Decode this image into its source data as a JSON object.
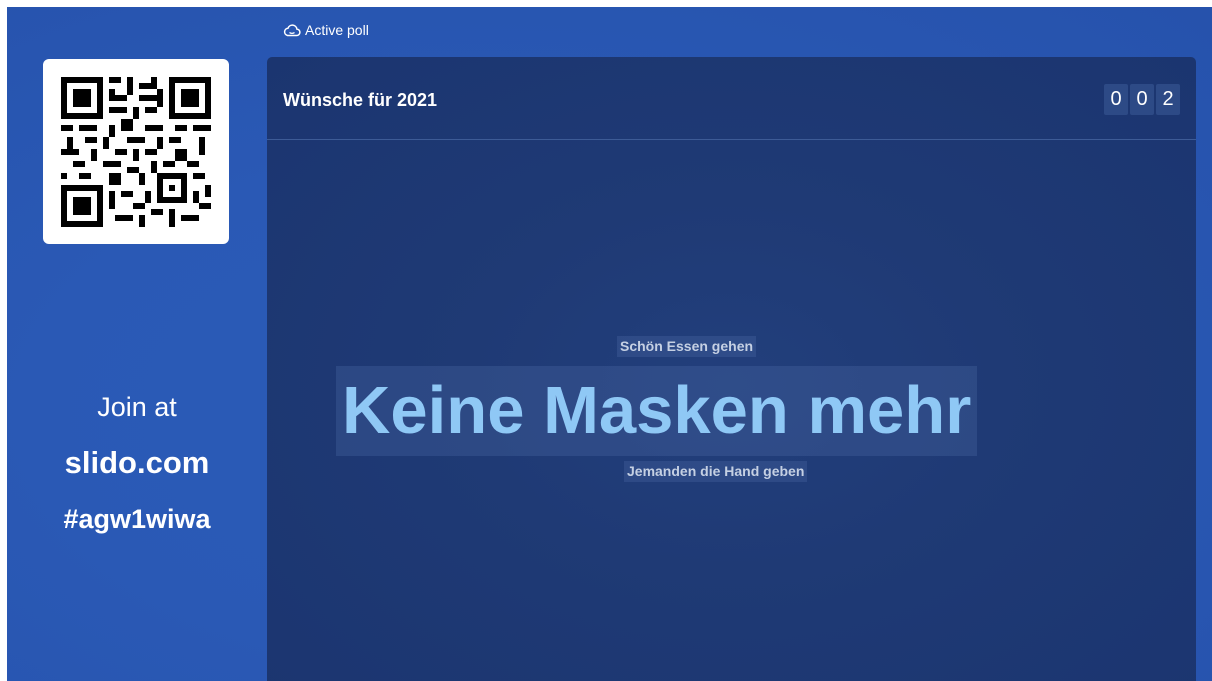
{
  "sidebar": {
    "join_text": "Join at",
    "join_url": "slido.com",
    "event_code": "#agw1wiwa",
    "qr_icon": "qr-code"
  },
  "topbar": {
    "status_label": "Active poll",
    "status_icon": "cloud-icon"
  },
  "poll": {
    "title": "Wünsche für 2021",
    "vote_count_digits": [
      "0",
      "0",
      "2"
    ]
  },
  "word_cloud": {
    "words": [
      {
        "text": "Schön Essen gehen",
        "weight": "small"
      },
      {
        "text": "Keine Masken mehr",
        "weight": "large"
      },
      {
        "text": "Jemanden die Hand geben",
        "weight": "small"
      }
    ]
  },
  "colors": {
    "background": "#2a59b5",
    "panel": "#1f3a75",
    "highlight_word": "#8fc8f5",
    "small_word": "#c5d0e3"
  }
}
